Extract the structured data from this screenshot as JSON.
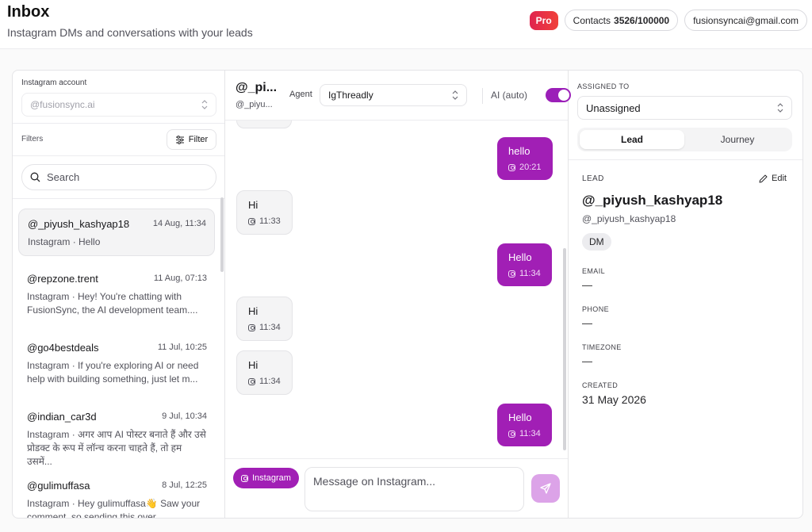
{
  "header": {
    "title": "Inbox",
    "subtitle": "Instagram DMs and conversations with your leads",
    "plan_badge": "Pro",
    "contacts_label": "Contacts",
    "contacts_value": "3526/100000",
    "account_email": "fusionsyncai@gmail.com"
  },
  "sidebar": {
    "account_label": "Instagram account",
    "account_value": "@fusionsync.ai",
    "filters_label": "Filters",
    "filter_button": "Filter",
    "search_placeholder": "Search",
    "conversations": [
      {
        "name": "@_piyush_kashyap18",
        "date": "14 Aug, 11:34",
        "preview": "Instagram · Hello",
        "active": true
      },
      {
        "name": "@repzone.trent",
        "date": "11 Aug, 07:13",
        "preview": "Instagram · Hey! You're chatting with FusionSync, the AI development team....",
        "active": false
      },
      {
        "name": "@go4bestdeals",
        "date": "11 Jul, 10:25",
        "preview": "Instagram · If you're exploring AI or need help with building something, just let m...",
        "active": false
      },
      {
        "name": "@indian_car3d",
        "date": "9 Jul, 10:34",
        "preview": "Instagram · अगर आप AI पोस्टर बनाते हैं और उसे प्रोडक्ट के रूप में लॉन्च करना चाहते हैं, तो हम उसमें...",
        "active": false
      },
      {
        "name": "@gulimuffasa",
        "date": "8 Jul, 12:25",
        "preview": "Instagram · Hey gulimuffasa👋 Saw your comment, so sending this over...",
        "active": false
      }
    ]
  },
  "chat": {
    "handle": "@_pi...",
    "sub_handle": "@_piyu...",
    "agent_label": "Agent",
    "agent_value": "IgThreadly",
    "ai_label": "AI (auto)",
    "ai_enabled": true,
    "messages": [
      {
        "direction": "out",
        "text": "hello",
        "time": "20:21"
      },
      {
        "direction": "in",
        "text": "Hi",
        "time": "11:33"
      },
      {
        "direction": "out",
        "text": "Hello",
        "time": "11:34"
      },
      {
        "direction": "in",
        "text": "Hi",
        "time": "11:34"
      },
      {
        "direction": "in",
        "text": "Hi",
        "time": "11:34"
      },
      {
        "direction": "out",
        "text": "Hello",
        "time": "11:34"
      }
    ],
    "channel_tag": "Instagram",
    "input_placeholder": "Message on Instagram..."
  },
  "details": {
    "assigned_label": "ASSIGNED TO",
    "assigned_value": "Unassigned",
    "tabs": [
      "Lead",
      "Journey"
    ],
    "active_tab": "Lead",
    "section_label": "LEAD",
    "edit_label": "Edit",
    "lead_name": "@_piyush_kashyap18",
    "lead_handle": "@_piyush_kashyap18",
    "channel_badge": "DM",
    "fields": [
      {
        "label": "EMAIL",
        "value": "—"
      },
      {
        "label": "PHONE",
        "value": "—"
      },
      {
        "label": "TIMEZONE",
        "value": "—"
      },
      {
        "label": "CREATED",
        "value": "31 May 2026"
      }
    ]
  },
  "colors": {
    "accent": "#a11fb5",
    "pro": "#e0244f"
  }
}
